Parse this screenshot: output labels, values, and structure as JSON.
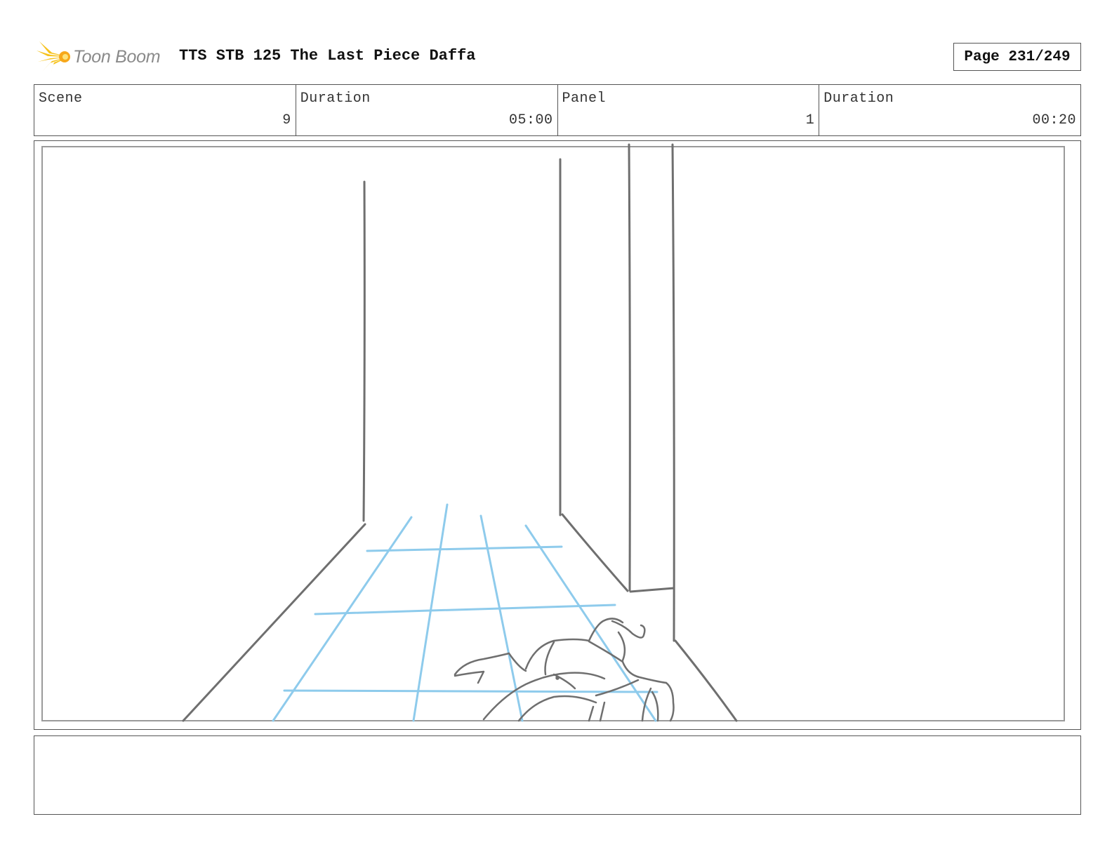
{
  "header": {
    "logo_text": "Toon Boom",
    "title": "TTS STB 125 The Last Piece Daffa",
    "page": "Page 231/249"
  },
  "info": {
    "scene_label": "Scene",
    "scene_value": "9",
    "scene_duration_label": "Duration",
    "scene_duration_value": "05:00",
    "panel_label": "Panel",
    "panel_value": "1",
    "panel_duration_label": "Duration",
    "panel_duration_value": "00:20"
  },
  "colors": {
    "sketch_gray": "#6f6f6f",
    "guide_blue": "#8ecbec",
    "logo_yellow": "#f6c21c"
  },
  "icons": {
    "logo": "toon-boom-burst-icon"
  },
  "notes": {
    "text": ""
  }
}
